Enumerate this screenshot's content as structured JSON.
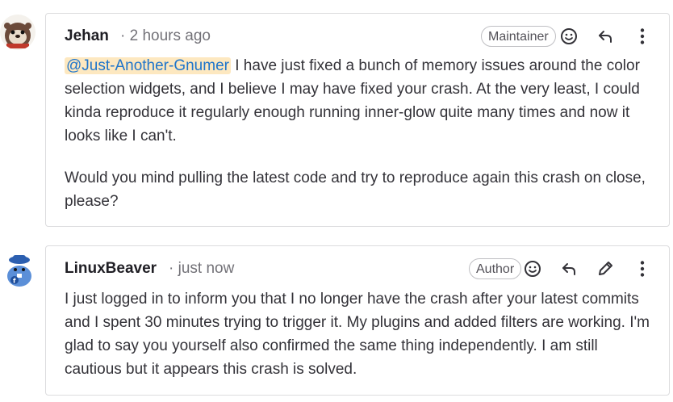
{
  "comments": [
    {
      "author": "Jehan",
      "time": "· 2 hours ago",
      "role": "Maintainer",
      "avatar_icon": "otter-avatar",
      "mention": "@Just-Another-Gnumer",
      "paragraph1_rest": " I have just fixed a bunch of memory issues around the color selection widgets, and I believe I may have fixed your crash. At the very least, I could kinda reproduce it regularly enough running inner-glow quite many times and now it looks like I can't.",
      "paragraph2": "Would you mind pulling the latest code and try to reproduce again this crash on close, please?",
      "actions": [
        "emoji-icon",
        "reply-icon",
        "more-actions-icon"
      ]
    },
    {
      "author": "LinuxBeaver",
      "time": "· just now",
      "role": "Author",
      "avatar_icon": "beaver-avatar",
      "body": "I just logged in to inform you that I no longer have the crash after your latest commits and I spent 30 minutes trying to trigger it. My plugins and added filters are working. I'm glad to say you yourself also confirmed the same thing independently. I am still cautious but it appears this crash is solved.",
      "actions": [
        "emoji-icon",
        "reply-icon",
        "edit-icon",
        "more-actions-icon"
      ]
    }
  ],
  "colors": {
    "mention_bg": "#fde8c0",
    "mention_text": "#1f75cb",
    "border": "#dcdcde",
    "muted": "#737278"
  }
}
